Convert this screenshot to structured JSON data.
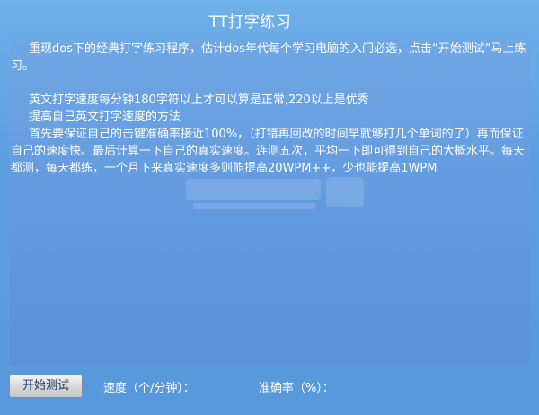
{
  "window": {
    "title": "TT打字练习"
  },
  "text_panel": {
    "paragraphs": [
      "重现dos下的经典打字练习程序，估计dos年代每个学习电脑的入门必选，点击“开始测试”马上练习。",
      "",
      "英文打字速度每分钟180字符以上才可以算是正常,220以上是优秀",
      "提高自己英文打字速度的方法",
      "首先要保证自己的击键准确率接近100%，（打错再回改的时间早就够打几个单词的了）再而保证自己的速度快。最后计算一下自己的真实速度。连测五次，平均一下即可得到自己的大概水平。每天都测，每天都练，一个月下来真实速度多则能提高20WPM++，少也能提高1WPM"
    ]
  },
  "bottom_bar": {
    "start_button_label": "开始测试",
    "speed_label": "速度（个/分钟）：",
    "accuracy_label": "准确率（%）："
  },
  "colors": {
    "background": "#5b9fdf",
    "panel": "#6fa6e4",
    "text": "#ffffff",
    "button_text": "#1c3a66"
  }
}
